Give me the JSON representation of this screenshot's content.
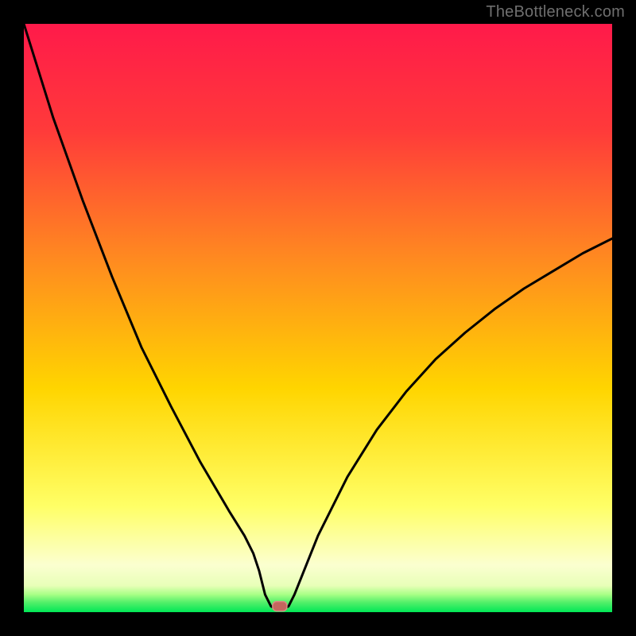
{
  "watermark": "TheBottleneck.com",
  "chart_data": {
    "type": "line",
    "title": "",
    "xlabel": "",
    "ylabel": "",
    "xlim": [
      0,
      100
    ],
    "ylim": [
      0,
      100
    ],
    "grid": false,
    "series": [
      {
        "name": "bottleneck-curve",
        "x": [
          0,
          5,
          10,
          15,
          20,
          25,
          30,
          35,
          37.5,
          39,
          40,
          41,
          42,
          43,
          44,
          45,
          46,
          48,
          50,
          55,
          60,
          65,
          70,
          75,
          80,
          85,
          90,
          95,
          100
        ],
        "values": [
          100,
          84,
          70,
          57,
          45,
          35,
          25.5,
          17,
          13,
          10,
          7,
          3,
          1,
          0.5,
          0.5,
          1,
          3,
          8,
          13,
          23,
          31,
          37.5,
          43,
          47.5,
          51.5,
          55,
          58,
          61,
          63.5
        ]
      }
    ],
    "marker": {
      "x": 43.5,
      "y": 1.0,
      "color": "#c4665e"
    },
    "bottom_band": {
      "y_start": 0,
      "y_end": 2.5
    }
  },
  "colors": {
    "gradient_top": "#ff1a4a",
    "gradient_mid1": "#ff6a2a",
    "gradient_mid2": "#ffd500",
    "gradient_low": "#ffff88",
    "gradient_band": "#fbffd6",
    "gradient_bottom": "#00e756",
    "curve": "#000000",
    "marker_fill": "#c4665e",
    "marker_stroke": "#d98a84",
    "frame": "#000000",
    "watermark": "#6f6f6f"
  }
}
